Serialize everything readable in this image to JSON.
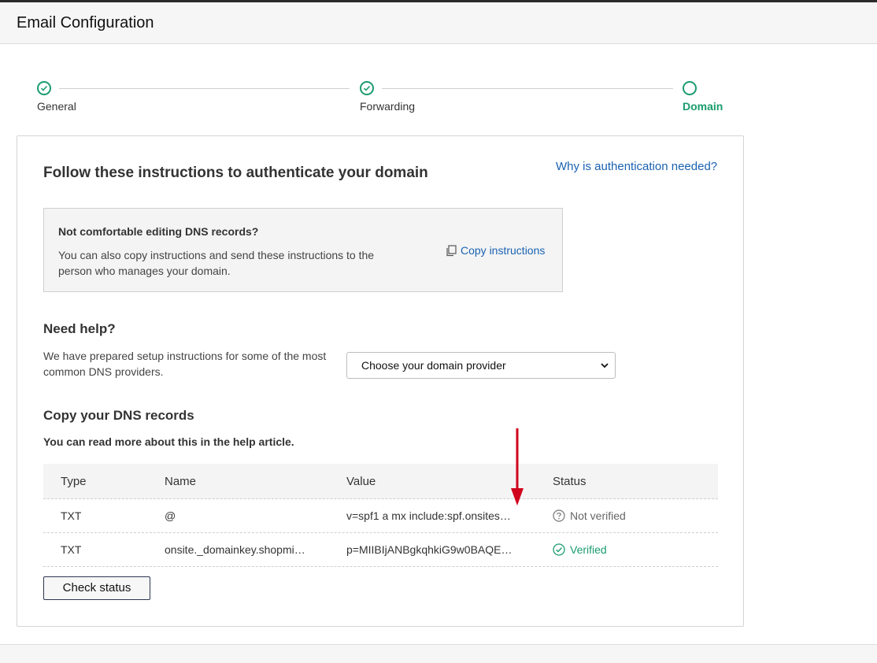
{
  "header": {
    "title": "Email Configuration"
  },
  "stepper": {
    "steps": [
      {
        "label": "General",
        "state": "complete"
      },
      {
        "label": "Forwarding",
        "state": "complete"
      },
      {
        "label": "Domain",
        "state": "current"
      }
    ]
  },
  "card": {
    "title": "Follow these instructions to authenticate your domain",
    "why_link": "Why is authentication needed?",
    "infobox": {
      "title": "Not comfortable editing DNS records?",
      "text": "You can also copy instructions and send these instructions to the person who manages your domain.",
      "copy_label": "Copy instructions"
    },
    "help": {
      "heading": "Need help?",
      "text": "We have prepared setup instructions for some of the most common DNS providers.",
      "select_value": "Choose your domain provider"
    },
    "dns": {
      "heading": "Copy your DNS records",
      "subtext": "You can read more about this in the help article.",
      "columns": [
        "Type",
        "Name",
        "Value",
        "Status"
      ],
      "rows": [
        {
          "type": "TXT",
          "name": "@",
          "value": "v=spf1 a mx include:spf.onsites…",
          "status": "Not verified"
        },
        {
          "type": "TXT",
          "name": "onsite._domainkey.shopmi…",
          "value": "p=MIIBIjANBgkqhkiG9w0BAQE…",
          "status": "Verified"
        }
      ]
    },
    "check_label": "Check status"
  },
  "colors": {
    "accent": "#1a9c6e",
    "link": "#1a62b0",
    "arrow": "#d0021b"
  },
  "icons": [
    "check-circle-icon",
    "empty-circle-icon",
    "copy-icon",
    "question-circle-icon",
    "chevron-down-icon",
    "down-arrow-annotation"
  ]
}
